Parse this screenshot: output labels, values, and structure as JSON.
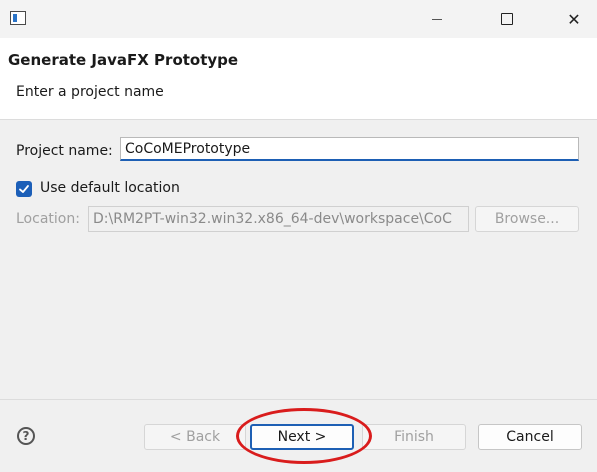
{
  "window": {
    "icon": "window-icon",
    "controls": {
      "minimize": "minimize-icon",
      "maximize": "maximize-icon",
      "close": "close-icon",
      "close_glyph": "✕"
    }
  },
  "header": {
    "title": "Generate JavaFX Prototype",
    "subtitle": "Enter a project name"
  },
  "form": {
    "project_name_label": "Project name:",
    "project_name_value": "CoCoMEPrototype",
    "use_default_checked": true,
    "use_default_label": "Use default location",
    "location_label": "Location:",
    "location_value": "D:\\RM2PT-win32.win32.x86_64-dev\\workspace\\CoC",
    "browse_label": "Browse..."
  },
  "footer": {
    "help_icon": "help-icon",
    "help_glyph": "?",
    "back_label": "< Back",
    "next_label": "Next >",
    "finish_label": "Finish",
    "cancel_label": "Cancel"
  },
  "colors": {
    "accent": "#1d5fb4",
    "highlight_annotation": "#d91c1c"
  }
}
